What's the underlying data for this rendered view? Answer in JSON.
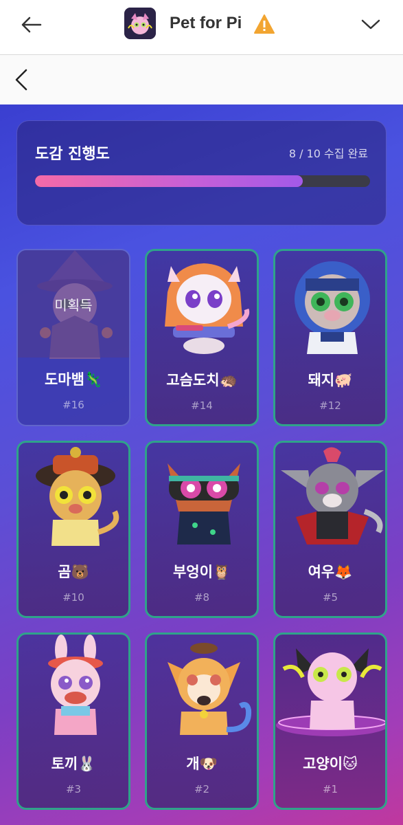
{
  "app_bar": {
    "title": "Pet for Pi"
  },
  "progress": {
    "title": "도감 진행도",
    "count_label": "8 / 10 수집 완료",
    "collected": 8,
    "total": 10
  },
  "collection": {
    "locked_label": "미획득",
    "pets": [
      {
        "name": "도마뱀🦎",
        "number": "#16",
        "locked": true
      },
      {
        "name": "고슴도치🦔",
        "number": "#14",
        "locked": false
      },
      {
        "name": "돼지🐖",
        "number": "#12",
        "locked": false
      },
      {
        "name": "곰🐻",
        "number": "#10",
        "locked": false
      },
      {
        "name": "부엉이🦉",
        "number": "#8",
        "locked": false
      },
      {
        "name": "여우🦊",
        "number": "#5",
        "locked": false
      },
      {
        "name": "토끼🐰",
        "number": "#3",
        "locked": false
      },
      {
        "name": "개🐶",
        "number": "#2",
        "locked": false
      },
      {
        "name": "고양이🐱",
        "number": "#1",
        "locked": false
      }
    ]
  },
  "colors": {
    "accent_border": "#2fa38a",
    "progress_start": "#f46aa8",
    "progress_end": "#a35ae8",
    "warning": "#f2a531"
  }
}
